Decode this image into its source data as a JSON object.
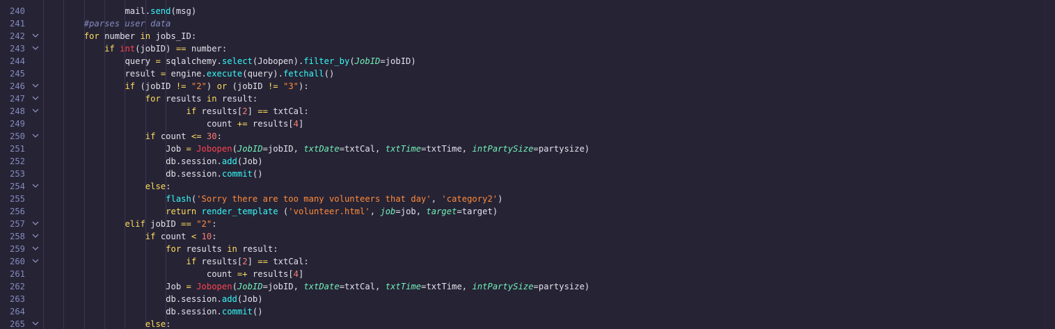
{
  "editor": {
    "colors": {
      "background": "#262335",
      "keyword": "#fede5d",
      "function": "#36f9f6",
      "string": "#ff8b39",
      "number": "#f97e72",
      "comment": "#848bbd",
      "builtin": "#fe4450",
      "param": "#72f1b8"
    },
    "lines": [
      {
        "n": "240",
        "fold": false,
        "indent": 4,
        "tokens": [
          [
            "mail.",
            ""
          ],
          [
            "send",
            "fn"
          ],
          [
            "(msg)",
            ""
          ]
        ]
      },
      {
        "n": "241",
        "fold": false,
        "indent": 2,
        "tokens": [
          [
            "#parses user data",
            "cm"
          ]
        ]
      },
      {
        "n": "242",
        "fold": true,
        "indent": 2,
        "tokens": [
          [
            "for",
            "kw"
          ],
          [
            " number ",
            ""
          ],
          [
            "in",
            "kw"
          ],
          [
            " jobs_ID:",
            ""
          ]
        ]
      },
      {
        "n": "243",
        "fold": true,
        "indent": 3,
        "tokens": [
          [
            "if",
            "kw"
          ],
          [
            " ",
            ""
          ],
          [
            "int",
            "bi"
          ],
          [
            "(jobID) ",
            ""
          ],
          [
            "==",
            "op"
          ],
          [
            " number:",
            ""
          ]
        ]
      },
      {
        "n": "244",
        "fold": false,
        "indent": 4,
        "tokens": [
          [
            "query ",
            ""
          ],
          [
            "=",
            "op"
          ],
          [
            " sqlalchemy.",
            ""
          ],
          [
            "select",
            "fn"
          ],
          [
            "(Jobopen).",
            ""
          ],
          [
            "filter_by",
            "fn"
          ],
          [
            "(",
            ""
          ],
          [
            "JobID",
            "prm"
          ],
          [
            "=jobID)",
            ""
          ]
        ]
      },
      {
        "n": "245",
        "fold": false,
        "indent": 4,
        "tokens": [
          [
            "result ",
            ""
          ],
          [
            "=",
            "op"
          ],
          [
            " engine.",
            ""
          ],
          [
            "execute",
            "fn"
          ],
          [
            "(query).",
            ""
          ],
          [
            "fetchall",
            "fn"
          ],
          [
            "()",
            ""
          ]
        ]
      },
      {
        "n": "246",
        "fold": true,
        "indent": 4,
        "tokens": [
          [
            "if",
            "kw"
          ],
          [
            " (jobID ",
            ""
          ],
          [
            "!=",
            "op"
          ],
          [
            " ",
            ""
          ],
          [
            "\"2\"",
            "str"
          ],
          [
            ") ",
            ""
          ],
          [
            "or",
            "kw"
          ],
          [
            " (jobID ",
            ""
          ],
          [
            "!=",
            "op"
          ],
          [
            " ",
            ""
          ],
          [
            "\"3\"",
            "str"
          ],
          [
            "):",
            ""
          ]
        ]
      },
      {
        "n": "247",
        "fold": true,
        "indent": 5,
        "tokens": [
          [
            "for",
            "kw"
          ],
          [
            " results ",
            ""
          ],
          [
            "in",
            "kw"
          ],
          [
            " result:",
            ""
          ]
        ]
      },
      {
        "n": "248",
        "fold": true,
        "indent": 7,
        "tokens": [
          [
            "if",
            "kw"
          ],
          [
            " results[",
            ""
          ],
          [
            "2",
            "num"
          ],
          [
            "] ",
            ""
          ],
          [
            "==",
            "op"
          ],
          [
            " txtCal:",
            ""
          ]
        ]
      },
      {
        "n": "249",
        "fold": false,
        "indent": 8,
        "tokens": [
          [
            "count ",
            ""
          ],
          [
            "+=",
            "op"
          ],
          [
            " results[",
            ""
          ],
          [
            "4",
            "num"
          ],
          [
            "]",
            ""
          ]
        ]
      },
      {
        "n": "250",
        "fold": true,
        "indent": 5,
        "tokens": [
          [
            "if",
            "kw"
          ],
          [
            " count ",
            ""
          ],
          [
            "<=",
            "op"
          ],
          [
            " ",
            ""
          ],
          [
            "30",
            "num"
          ],
          [
            ":",
            ""
          ]
        ]
      },
      {
        "n": "251",
        "fold": false,
        "indent": 6,
        "tokens": [
          [
            "Job ",
            ""
          ],
          [
            "=",
            "op"
          ],
          [
            " ",
            ""
          ],
          [
            "Jobopen",
            "cls"
          ],
          [
            "(",
            ""
          ],
          [
            "JobID",
            "prm"
          ],
          [
            "=jobID, ",
            ""
          ],
          [
            "txtDate",
            "prm"
          ],
          [
            "=txtCal, ",
            ""
          ],
          [
            "txtTime",
            "prm"
          ],
          [
            "=txtTime, ",
            ""
          ],
          [
            "intPartySize",
            "prm"
          ],
          [
            "=partysize)",
            ""
          ]
        ]
      },
      {
        "n": "252",
        "fold": false,
        "indent": 6,
        "tokens": [
          [
            "db.session.",
            ""
          ],
          [
            "add",
            "fn"
          ],
          [
            "(Job)",
            ""
          ]
        ]
      },
      {
        "n": "253",
        "fold": false,
        "indent": 6,
        "tokens": [
          [
            "db.session.",
            ""
          ],
          [
            "commit",
            "fn"
          ],
          [
            "()",
            ""
          ]
        ]
      },
      {
        "n": "254",
        "fold": true,
        "indent": 5,
        "tokens": [
          [
            "else",
            "kw"
          ],
          [
            ":",
            ""
          ]
        ]
      },
      {
        "n": "255",
        "fold": false,
        "indent": 6,
        "tokens": [
          [
            "flash",
            "fn"
          ],
          [
            "(",
            ""
          ],
          [
            "'Sorry there are too many volunteers that day'",
            "str"
          ],
          [
            ", ",
            ""
          ],
          [
            "'category2'",
            "str"
          ],
          [
            ")",
            ""
          ]
        ]
      },
      {
        "n": "256",
        "fold": false,
        "indent": 6,
        "tokens": [
          [
            "return",
            "kw"
          ],
          [
            " ",
            ""
          ],
          [
            "render_template",
            "fn"
          ],
          [
            " (",
            ""
          ],
          [
            "'volunteer.html'",
            "str"
          ],
          [
            ", ",
            ""
          ],
          [
            "job",
            "prm"
          ],
          [
            "=job, ",
            ""
          ],
          [
            "target",
            "prm"
          ],
          [
            "=target)",
            ""
          ]
        ]
      },
      {
        "n": "257",
        "fold": true,
        "indent": 4,
        "tokens": [
          [
            "elif",
            "kw"
          ],
          [
            " jobID ",
            ""
          ],
          [
            "==",
            "op"
          ],
          [
            " ",
            ""
          ],
          [
            "\"2\"",
            "str"
          ],
          [
            ":",
            ""
          ]
        ]
      },
      {
        "n": "258",
        "fold": true,
        "indent": 5,
        "tokens": [
          [
            "if",
            "kw"
          ],
          [
            " count ",
            ""
          ],
          [
            "<",
            "op"
          ],
          [
            " ",
            ""
          ],
          [
            "10",
            "num"
          ],
          [
            ":",
            ""
          ]
        ]
      },
      {
        "n": "259",
        "fold": true,
        "indent": 6,
        "tokens": [
          [
            "for",
            "kw"
          ],
          [
            " results ",
            ""
          ],
          [
            "in",
            "kw"
          ],
          [
            " result:",
            ""
          ]
        ]
      },
      {
        "n": "260",
        "fold": true,
        "indent": 7,
        "tokens": [
          [
            "if",
            "kw"
          ],
          [
            " results[",
            ""
          ],
          [
            "2",
            "num"
          ],
          [
            "] ",
            ""
          ],
          [
            "==",
            "op"
          ],
          [
            " txtCal:",
            ""
          ]
        ]
      },
      {
        "n": "261",
        "fold": false,
        "indent": 8,
        "tokens": [
          [
            "count ",
            ""
          ],
          [
            "=+",
            "op"
          ],
          [
            " results[",
            ""
          ],
          [
            "4",
            "num"
          ],
          [
            "]",
            ""
          ]
        ]
      },
      {
        "n": "262",
        "fold": false,
        "indent": 6,
        "tokens": [
          [
            "Job ",
            ""
          ],
          [
            "=",
            "op"
          ],
          [
            " ",
            ""
          ],
          [
            "Jobopen",
            "cls"
          ],
          [
            "(",
            ""
          ],
          [
            "JobID",
            "prm"
          ],
          [
            "=jobID, ",
            ""
          ],
          [
            "txtDate",
            "prm"
          ],
          [
            "=txtCal, ",
            ""
          ],
          [
            "txtTime",
            "prm"
          ],
          [
            "=txtTime, ",
            ""
          ],
          [
            "intPartySize",
            "prm"
          ],
          [
            "=partysize)",
            ""
          ]
        ]
      },
      {
        "n": "263",
        "fold": false,
        "indent": 6,
        "tokens": [
          [
            "db.session.",
            ""
          ],
          [
            "add",
            "fn"
          ],
          [
            "(Job)",
            ""
          ]
        ]
      },
      {
        "n": "264",
        "fold": false,
        "indent": 6,
        "tokens": [
          [
            "db.session.",
            ""
          ],
          [
            "commit",
            "fn"
          ],
          [
            "()",
            ""
          ]
        ]
      },
      {
        "n": "265",
        "fold": true,
        "indent": 5,
        "tokens": [
          [
            "else",
            "kw"
          ],
          [
            ":",
            ""
          ]
        ]
      }
    ]
  }
}
